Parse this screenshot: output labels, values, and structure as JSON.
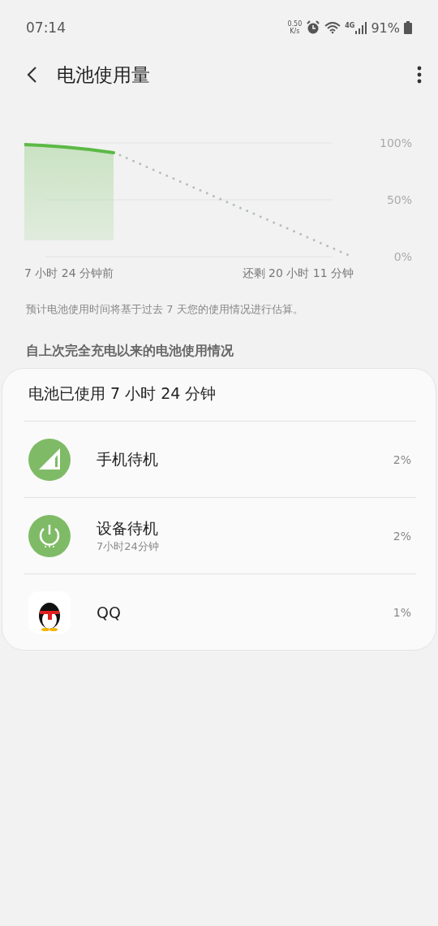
{
  "status_bar": {
    "time": "07:14",
    "net_speed_value": "0.50",
    "net_speed_unit": "K/s",
    "network_type": "4G",
    "battery": "91%"
  },
  "header": {
    "title": "电池使用量"
  },
  "chart": {
    "start_label": "7 小时 24 分钟前",
    "end_label": "还剩 20 小时 11 分钟",
    "y_labels": [
      "100%",
      "50%",
      "0%"
    ]
  },
  "note": "预计电池使用时间将基于过去 7 天您的使用情况进行估算。",
  "section_title": "自上次完全充电以来的电池使用情况",
  "card": {
    "title": "电池已使用 7 小时 24 分钟",
    "items": [
      {
        "kind": "signal",
        "name": "手机待机",
        "percent": "2%"
      },
      {
        "kind": "power",
        "name": "设备待机",
        "detail": "7小时24分钟",
        "percent": "2%"
      },
      {
        "kind": "app",
        "name": "QQ",
        "percent": "1%"
      }
    ]
  }
}
